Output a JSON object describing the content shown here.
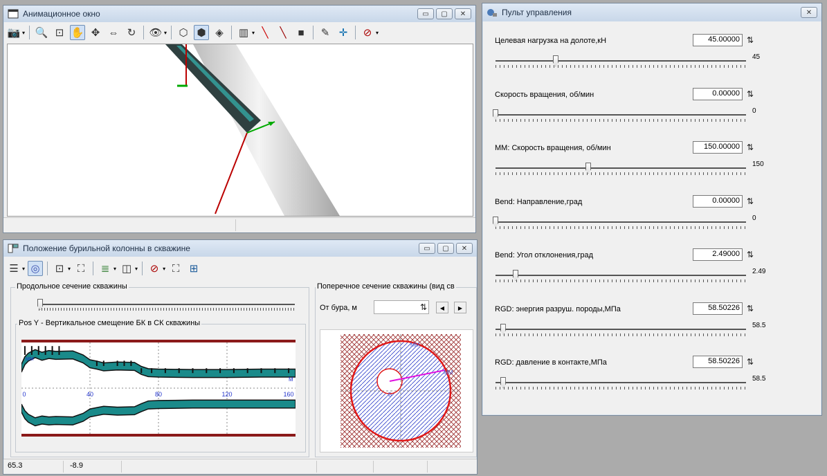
{
  "animation_window": {
    "title": "Анимационное окно"
  },
  "position_window": {
    "title": "Положение бурильной колонны в скважине",
    "longitudinal_label": "Продольное сечение скважины",
    "chart_title": "Pos Y - Вертикальное смещение БК в СК скважины",
    "cross_label": "Поперечное сечение скважины (вид св",
    "from_bit_label": "От бура, м",
    "status": [
      "65.3",
      "-8.9"
    ]
  },
  "control_panel": {
    "title": "Пульт управления",
    "params": [
      {
        "label": "Целевая нагрузка на долоте,кН",
        "value": "45.00000",
        "slider_text": "45",
        "position": 0.24
      },
      {
        "label": "Скорость вращения, об/мин",
        "value": "0.00000",
        "slider_text": "0",
        "position": 0.0
      },
      {
        "label": "ММ: Скорость вращения, об/мин",
        "value": "150.00000",
        "slider_text": "150",
        "position": 0.37
      },
      {
        "label": "Bend: Направление,град",
        "value": "0.00000",
        "slider_text": "0",
        "position": 0.0
      },
      {
        "label": "Bend: Угол отклонения,град",
        "value": "2.49000",
        "slider_text": "2.49",
        "position": 0.08
      },
      {
        "label": "RGD: энергия разруш. породы,МПа",
        "value": "58.50226",
        "slider_text": "58.5",
        "position": 0.03
      },
      {
        "label": "RGD: давление в контакте,МПа",
        "value": "58.50226",
        "slider_text": "58.5",
        "position": 0.03
      }
    ]
  },
  "chart_data": [
    {
      "type": "line",
      "title": "Pos Y - Вертикальное смещение БК в СК скважины",
      "x_tick_labels": [
        "0",
        "40",
        "80",
        "120",
        "160"
      ],
      "xlim": [
        0,
        160
      ],
      "axis_labels": [
        "ММ",
        "М"
      ],
      "series": [
        {
          "x": [
            0,
            2,
            4,
            8,
            12,
            16,
            20,
            30,
            36,
            40,
            44,
            48,
            56,
            66,
            70,
            74,
            80,
            100,
            120,
            140,
            160
          ],
          "y": [
            0.45,
            0.62,
            0.7,
            0.78,
            0.72,
            0.76,
            0.74,
            0.75,
            0.66,
            0.55,
            0.52,
            0.48,
            0.5,
            0.49,
            0.4,
            0.35,
            0.34,
            0.33,
            0.33,
            0.34,
            0.34
          ]
        },
        {
          "x": [
            0,
            2,
            4,
            8,
            12,
            16,
            20,
            30,
            36,
            40,
            44,
            48,
            56,
            66,
            70,
            74,
            80,
            100,
            120,
            140,
            160
          ],
          "y": [
            -0.45,
            -0.6,
            -0.68,
            -0.76,
            -0.72,
            -0.74,
            -0.73,
            -0.74,
            -0.66,
            -0.56,
            -0.53,
            -0.5,
            -0.52,
            -0.51,
            -0.44,
            -0.38,
            -0.37,
            -0.36,
            -0.36,
            -0.36,
            -0.36
          ]
        }
      ],
      "grid": true
    }
  ],
  "cross_section": {
    "label_mm": "ММ",
    "label_mm2": "ММ",
    "label_b": "Б"
  }
}
